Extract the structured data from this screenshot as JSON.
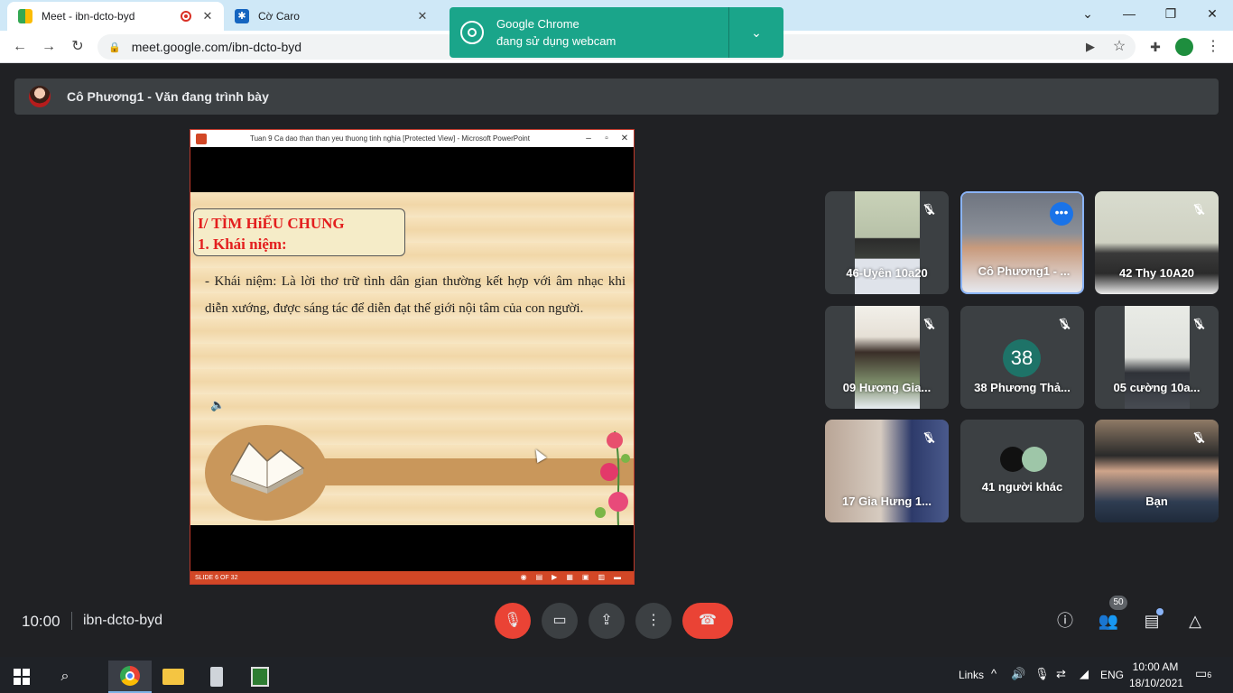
{
  "browser": {
    "tabs": [
      {
        "title": "Meet - ibn-dcto-byd",
        "favicon": "google-meet-icon"
      },
      {
        "title": "Cờ Caro",
        "favicon": "star-icon"
      }
    ],
    "url": "meet.google.com/ibn-dcto-byd",
    "popup": {
      "line1": "Google Chrome",
      "line2": "đang sử dụng webcam"
    }
  },
  "meet": {
    "presenter_text": "Cô Phương1 - Văn đang trình bày",
    "presentation": {
      "window_title": "Tuan 9 Ca dao than than yeu thuong tinh nghia [Protected View] - Microsoft PowerPoint",
      "heading1": "I/ TÌM  HiỂU CHUNG",
      "heading2": "1. Khái niệm:",
      "body": "- Khái niệm:  Là lời thơ trữ tình dân gian thường kết hợp với âm nhạc khi diễn xướng, được sáng tác để diễn đạt thế giới nội tâm của con người.",
      "status": "SLIDE 6 OF 32"
    },
    "participants": [
      {
        "name": "46-Uyên 10a20",
        "muted": true
      },
      {
        "name": "Cô Phương1 - ...",
        "muted": false
      },
      {
        "name": "42 Thy 10A20",
        "muted": true
      },
      {
        "name": "09 Hương Gia...",
        "muted": true
      },
      {
        "name": "38 Phương Thả...",
        "muted": true,
        "avatar_text": "38"
      },
      {
        "name": "05 cường 10a...",
        "muted": true
      },
      {
        "name": "17 Gia Hưng 1...",
        "muted": true
      },
      {
        "name": "41 người khác",
        "muted": false
      },
      {
        "name": "Bạn",
        "muted": true
      }
    ],
    "time": "10:00",
    "code": "ibn-dcto-byd",
    "people_count": "50"
  },
  "taskbar": {
    "links_label": "Links",
    "lang": "ENG",
    "clock_time": "10:00 AM",
    "clock_date": "18/10/2021",
    "notif_count": "6"
  },
  "colors": {
    "accent": "#1a73e8",
    "hangup": "#ea4335",
    "meet_bg": "#202124",
    "popup": "#1aa58a"
  }
}
